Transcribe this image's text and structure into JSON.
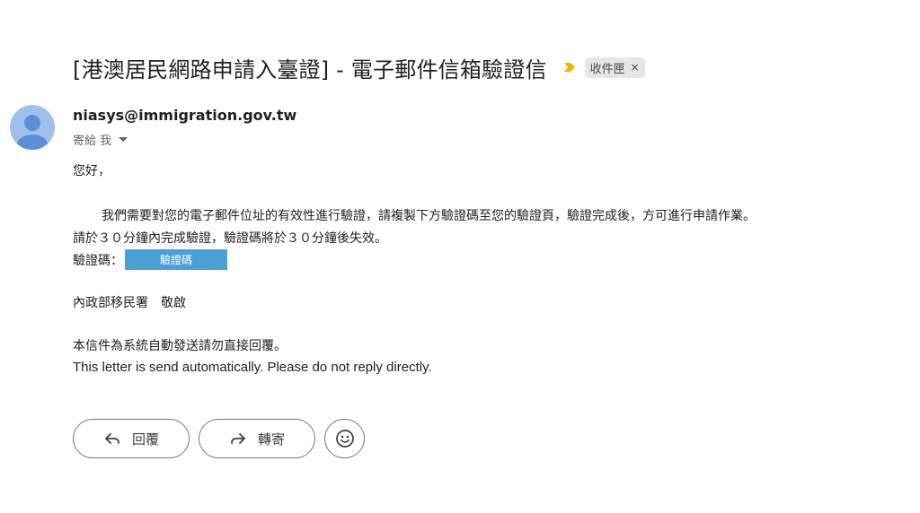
{
  "email": {
    "subject": "[港澳居民網路申請入臺證] - 電子郵件信箱驗證信",
    "label": "收件匣",
    "label_close": "×",
    "sender": "niasys@immigration.gov.tw",
    "recipient": "寄給 我"
  },
  "body": {
    "greeting": "您好，",
    "line1": "我們需要對您的電子郵件位址的有效性進行驗證，請複製下方驗證碼至您的驗證頁，驗證完成後，方可進行申請作業。",
    "line2": "請於３０分鐘內完成驗證，驗證碼將於３０分鐘後失效。",
    "code_label": "驗證碼：",
    "code_value": "驗證碼",
    "signature": "內政部移民署　敬啟",
    "auto_notice": "本信件為系統自動發送請勿直接回覆。",
    "auto_notice_en": "This letter is send automatically. Please do not reply directly."
  },
  "actions": {
    "reply": "回覆",
    "forward": "轉寄"
  },
  "colors": {
    "importance": "#f4b400",
    "avatar_bg": "#9fc0ea",
    "avatar_fg": "#5b8fd8",
    "code_box": "#4a9fd6"
  },
  "icons": {
    "importance": "importance-marker-icon",
    "avatar": "person-avatar-icon",
    "reply": "reply-arrow-icon",
    "forward": "forward-arrow-icon",
    "emoji": "smiley-emoji-icon"
  }
}
